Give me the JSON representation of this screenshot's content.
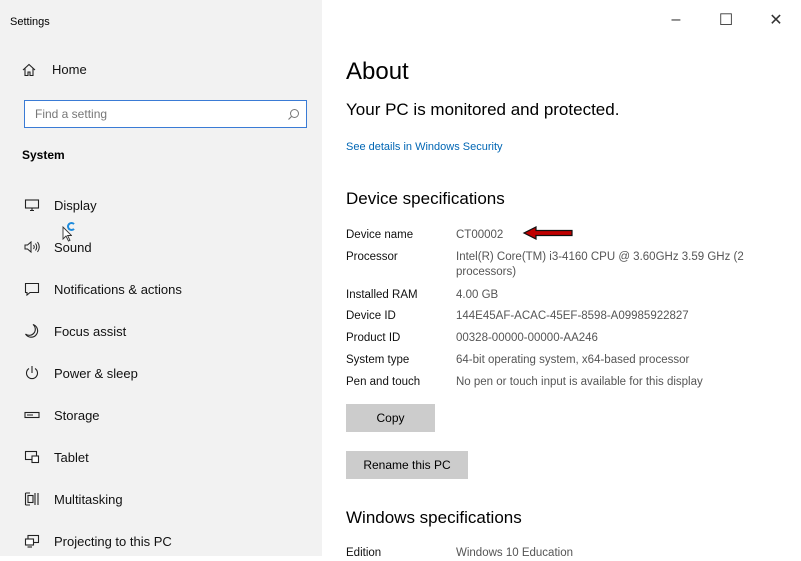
{
  "window": {
    "title": "Settings",
    "minimize_glyph": "–",
    "maximize_glyph": "☐",
    "close_glyph": "✕"
  },
  "sidebar": {
    "home_label": "Home",
    "search_placeholder": "Find a setting",
    "section_title": "System",
    "items": [
      {
        "label": "Display",
        "icon": "display-icon"
      },
      {
        "label": "Sound",
        "icon": "speaker-icon"
      },
      {
        "label": "Notifications & actions",
        "icon": "notification-icon"
      },
      {
        "label": "Focus assist",
        "icon": "moon-icon"
      },
      {
        "label": "Power & sleep",
        "icon": "power-icon"
      },
      {
        "label": "Storage",
        "icon": "storage-icon"
      },
      {
        "label": "Tablet",
        "icon": "tablet-icon"
      },
      {
        "label": "Multitasking",
        "icon": "multitasking-icon"
      },
      {
        "label": "Projecting to this PC",
        "icon": "projecting-icon"
      }
    ]
  },
  "main": {
    "title": "About",
    "protection_status": "Your PC is monitored and protected.",
    "security_link": "See details in Windows Security",
    "device_specs_heading": "Device specifications",
    "specs": [
      {
        "label": "Device name",
        "value": "CT00002"
      },
      {
        "label": "Processor",
        "value": "Intel(R) Core(TM) i3-4160 CPU @ 3.60GHz   3.59 GHz  (2 processors)"
      },
      {
        "label": "Installed RAM",
        "value": "4.00 GB"
      },
      {
        "label": "Device ID",
        "value": "144E45AF-ACAC-45EF-8598-A09985922827"
      },
      {
        "label": "Product ID",
        "value": "00328-00000-00000-AA246"
      },
      {
        "label": "System type",
        "value": "64-bit operating system, x64-based processor"
      },
      {
        "label": "Pen and touch",
        "value": "No pen or touch input is available for this display"
      }
    ],
    "copy_button": "Copy",
    "rename_button": "Rename this PC",
    "windows_specs_heading": "Windows specifications",
    "windows_specs": [
      {
        "label": "Edition",
        "value": "Windows 10 Education"
      }
    ]
  },
  "colors": {
    "accent": "#0066b4",
    "annotation_arrow": "#c00000"
  }
}
